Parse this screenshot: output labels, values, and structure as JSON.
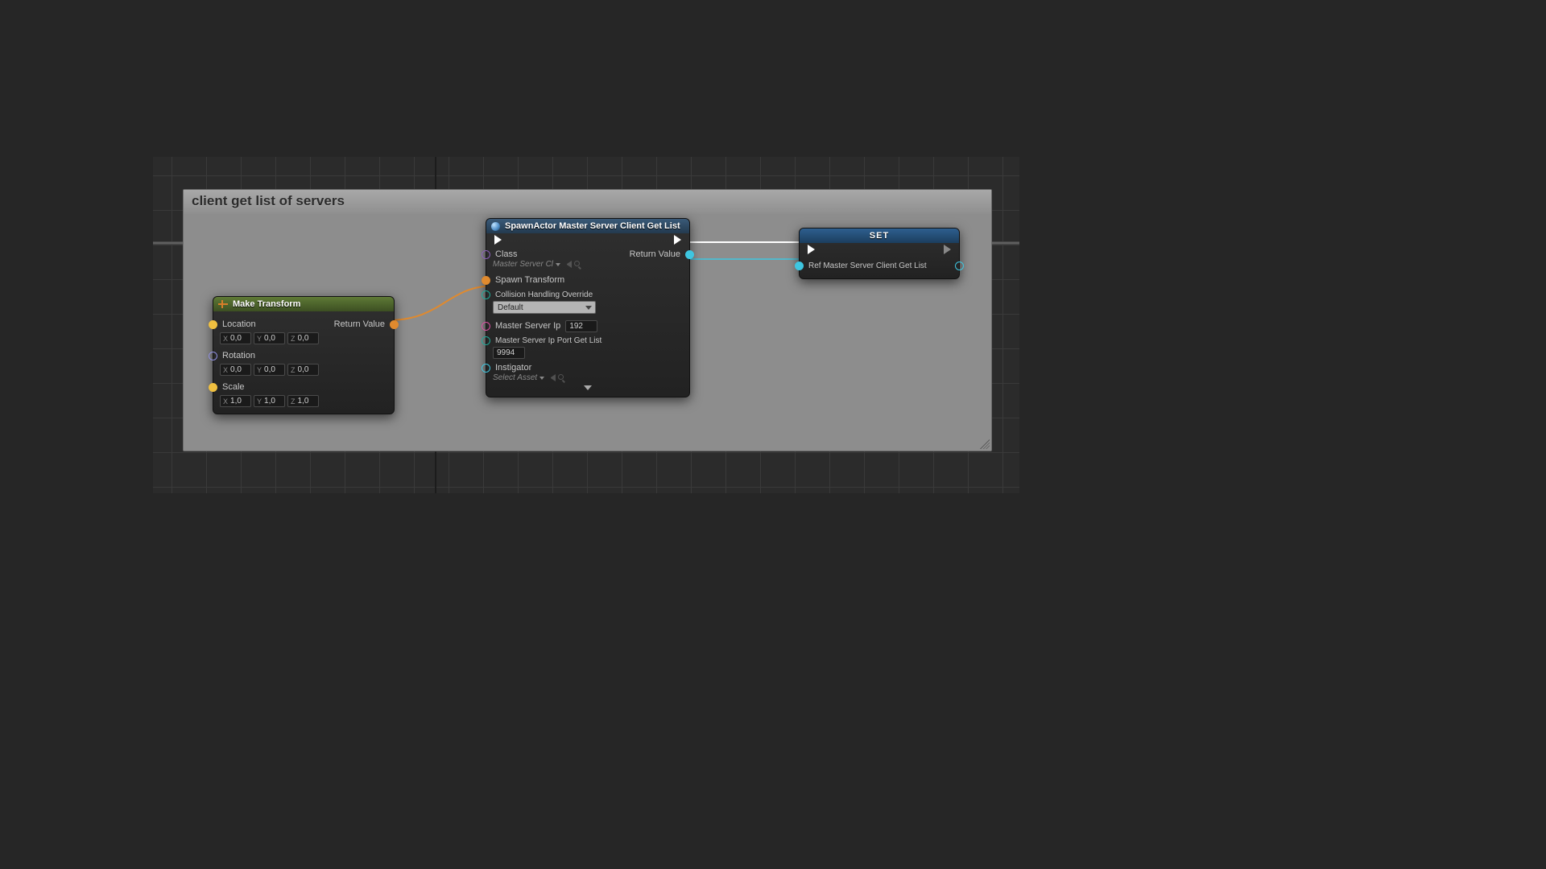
{
  "comment": {
    "title": "client get list of servers"
  },
  "make_transform": {
    "title": "Make Transform",
    "return_label": "Return Value",
    "location": {
      "label": "Location",
      "x": "0,0",
      "y": "0,0",
      "z": "0,0"
    },
    "rotation": {
      "label": "Rotation",
      "x": "0,0",
      "y": "0,0",
      "z": "0,0"
    },
    "scale": {
      "label": "Scale",
      "x": "1,0",
      "y": "1,0",
      "z": "1,0"
    }
  },
  "spawn": {
    "title": "SpawnActor Master Server Client Get List",
    "class_label": "Class",
    "class_value": "Master Server Cl",
    "return_label": "Return Value",
    "spawn_transform": "Spawn Transform",
    "collision_label": "Collision Handling Override",
    "collision_value": "Default",
    "master_ip_label": "Master Server Ip",
    "master_ip_value": "192",
    "port_label": "Master Server Ip Port Get List",
    "port_value": "9994",
    "instigator_label": "Instigator",
    "instigator_value": "Select Asset"
  },
  "set": {
    "title": "SET",
    "ref_label": "Ref Master Server Client Get List"
  }
}
